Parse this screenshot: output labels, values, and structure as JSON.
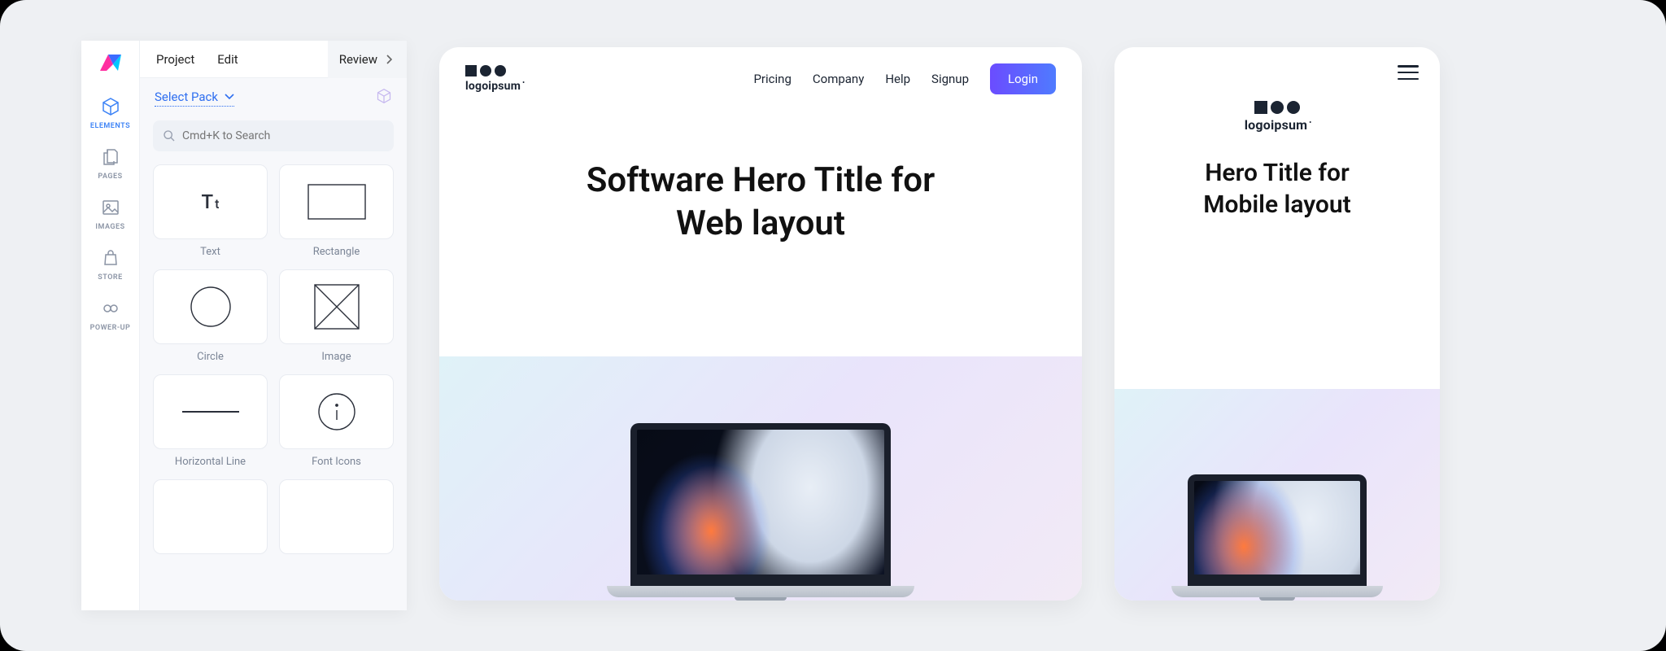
{
  "editor": {
    "menu": {
      "project": "Project",
      "edit": "Edit",
      "review": "Review"
    },
    "select_pack": "Select Pack",
    "search_placeholder": "Cmd+K to Search",
    "rail": {
      "elements": "ELEMENTS",
      "pages": "PAGES",
      "images": "IMAGES",
      "store": "STORE",
      "powerup": "POWER-UP"
    },
    "tiles": {
      "text": "Text",
      "rectangle": "Rectangle",
      "circle": "Circle",
      "image": "Image",
      "hline": "Horizontal Line",
      "fonticons": "Font Icons"
    }
  },
  "web": {
    "logo": "logoipsum",
    "nav": {
      "pricing": "Pricing",
      "company": "Company",
      "help": "Help",
      "signup": "Signup",
      "login": "Login"
    },
    "hero": "Software Hero Title for\nWeb layout"
  },
  "mobile": {
    "logo": "logoipsum",
    "hero": "Hero Title for\nMobile layout"
  }
}
